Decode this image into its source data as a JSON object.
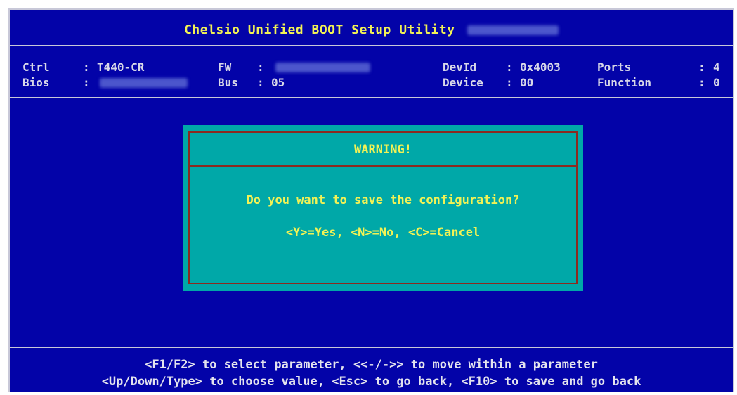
{
  "title": {
    "text": "Chelsio Unified BOOT Setup Utility"
  },
  "header": {
    "ctrl_label": "Ctrl",
    "ctrl_sep": ":",
    "ctrl_value": "T440-CR",
    "bios_label": "Bios",
    "bios_sep": ":",
    "fw_label": "FW",
    "fw_sep": ":",
    "bus_label": "Bus",
    "bus_sep": ":",
    "bus_value": "05",
    "devid_label": "DevId",
    "devid_sep": ":",
    "devid_value": "0x4003",
    "device_label": "Device",
    "device_sep": ":",
    "device_value": "00",
    "ports_label": "Ports",
    "ports_sep": ":",
    "ports_value": "4",
    "function_label": "Function",
    "function_sep": ":",
    "function_value": "0"
  },
  "dialog": {
    "title": "WARNING!",
    "question": "Do you want to save the configuration?",
    "options": "<Y>=Yes, <N>=No, <C>=Cancel"
  },
  "footer": {
    "line1": "<F1/F2> to select parameter, <<-/->> to move within a parameter",
    "line2": "<Up/Down/Type> to choose value, <Esc> to go back, <F10> to save and go back"
  },
  "colors": {
    "background": "#0303a8",
    "title": "#f2f255",
    "dialog_bg": "#00a8a8",
    "dialog_border": "#8b2a20",
    "text": "#d8d8e8"
  }
}
